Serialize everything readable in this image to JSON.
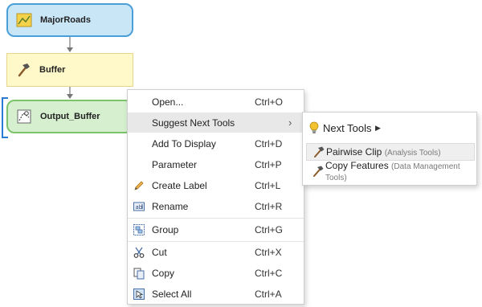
{
  "nodes": {
    "input": {
      "label": "MajorRoads"
    },
    "tool": {
      "label": "Buffer"
    },
    "output": {
      "label": "Output_Buffer"
    }
  },
  "context_menu": {
    "items": [
      {
        "label": "Open...",
        "shortcut": "Ctrl+O",
        "icon": "none"
      },
      {
        "label": "Suggest Next Tools",
        "shortcut": "",
        "icon": "none",
        "submenu": true
      },
      {
        "label": "Add To Display",
        "shortcut": "Ctrl+D",
        "icon": "none"
      },
      {
        "label": "Parameter",
        "shortcut": "Ctrl+P",
        "icon": "none"
      },
      {
        "label": "Create Label",
        "shortcut": "Ctrl+L",
        "icon": "pencil-icon"
      },
      {
        "label": "Rename",
        "shortcut": "Ctrl+R",
        "icon": "rename-icon"
      },
      {
        "label": "Group",
        "shortcut": "Ctrl+G",
        "icon": "group-icon"
      },
      {
        "label": "Cut",
        "shortcut": "Ctrl+X",
        "icon": "scissors-icon"
      },
      {
        "label": "Copy",
        "shortcut": "Ctrl+C",
        "icon": "copy-icon"
      },
      {
        "label": "Select All",
        "shortcut": "Ctrl+A",
        "icon": "select-all-icon"
      }
    ]
  },
  "submenu": {
    "header": "Next Tools",
    "items": [
      {
        "label": "Pairwise Clip",
        "hint": "(Analysis Tools)",
        "icon": "hammer-icon"
      },
      {
        "label": "Copy Features",
        "hint": "(Data Management Tools)",
        "icon": "hammer-icon"
      }
    ]
  },
  "colors": {
    "input_fill": "#c9e6f7",
    "input_border": "#4b9fd9",
    "tool_fill": "#fff8c8",
    "output_fill": "#d5efcf",
    "output_border": "#7cc36b",
    "hover": "#e8e8e8",
    "bulb": "#f2c230"
  }
}
